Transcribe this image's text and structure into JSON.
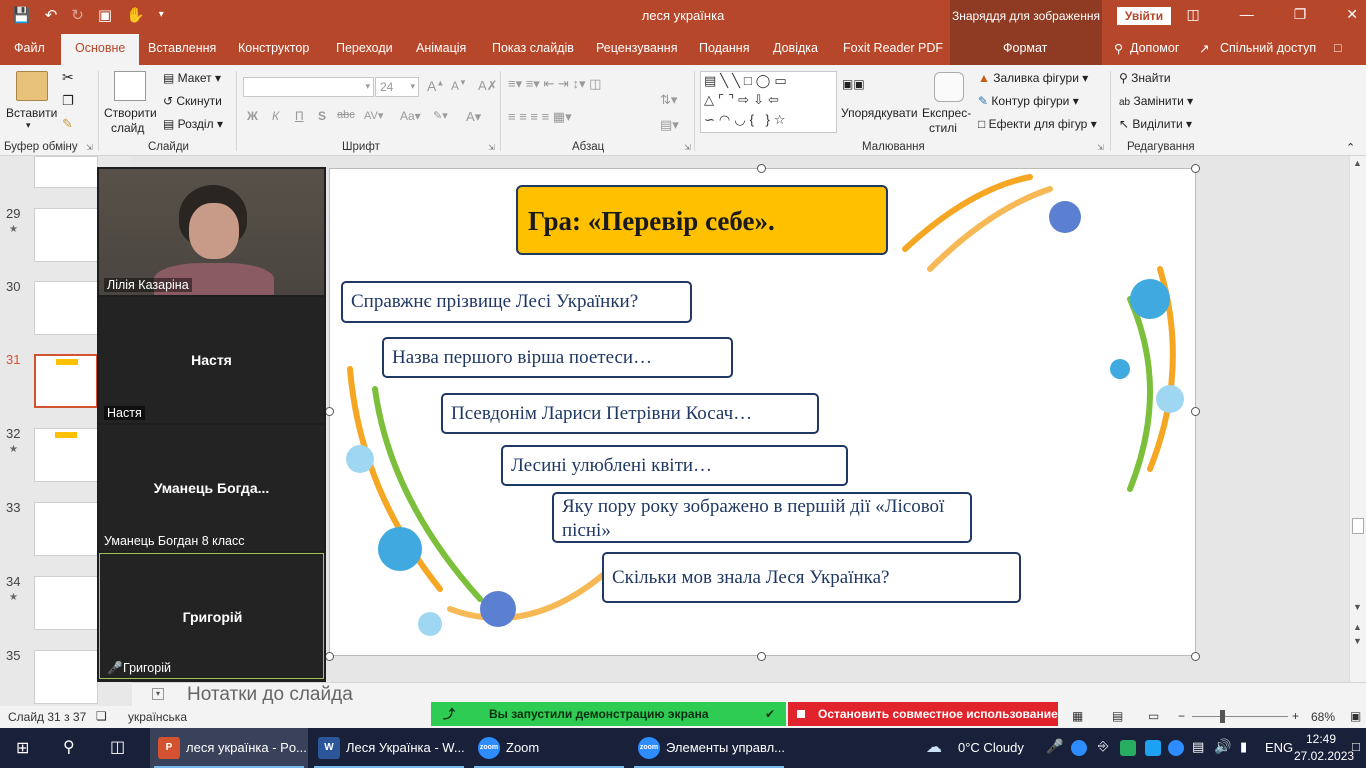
{
  "titlebar": {
    "doc_title": "леся українка",
    "context_tools": "Знаряддя для зображення",
    "signin": "Увійти"
  },
  "tabs": [
    "Файл",
    "Основне",
    "Вставлення",
    "Конструктор",
    "Переходи",
    "Анімація",
    "Показ слайдів",
    "Рецензування",
    "Подання",
    "Довідка",
    "Foxit Reader PDF",
    "Формат"
  ],
  "tabs_right": {
    "help": "Допомог",
    "share": "Спільний доступ"
  },
  "ribbon": {
    "paste": "Вставити",
    "clipboard_group": "Буфер обміну",
    "new_slide_1": "Створити",
    "new_slide_2": "слайд",
    "layout": "Макет",
    "reset": "Скинути",
    "section": "Розділ",
    "slides_group": "Слайди",
    "font_size": "24",
    "font_group": "Шрифт",
    "bold": "Ж",
    "italic": "К",
    "underline": "П",
    "shadow": "S",
    "strike": "abc",
    "paragraph_group": "Абзац",
    "arrange": "Упорядкувати",
    "quick_styles_1": "Експрес-",
    "quick_styles_2": "стилі",
    "shape_fill": "Заливка фігури",
    "shape_outline": "Контур фігури",
    "shape_effects": "Ефекти для фігур",
    "drawing_group": "Малювання",
    "find": "Знайти",
    "replace": "Замінити",
    "select": "Виділити",
    "editing_group": "Редагування"
  },
  "thumbnails": [
    {
      "num": "29",
      "star": "★"
    },
    {
      "num": "30",
      "star": ""
    },
    {
      "num": "31",
      "star": ""
    },
    {
      "num": "32",
      "star": "★"
    },
    {
      "num": "33",
      "star": ""
    },
    {
      "num": "34",
      "star": "★"
    },
    {
      "num": "35",
      "star": ""
    }
  ],
  "slide": {
    "title": "Гра: «Перевір себе».",
    "questions": [
      "Справжнє прізвище Лесі Українки?",
      "Назва першого вірша поетеси…",
      "Псевдонім Лариси Петрівни Косач…",
      "Лесині улюблені квіти…",
      "Яку пору року зображено в першій дії «Лісової пісні»",
      "Скільки мов знала Леся Українка?"
    ]
  },
  "zoom": {
    "participants": [
      {
        "label": "Лілія Казаріна",
        "center": ""
      },
      {
        "label": "Настя",
        "center": "Настя"
      },
      {
        "label": "Уманець Богдан 8 класс",
        "center": "Уманець  Богда..."
      },
      {
        "label": "Григорій",
        "center": "Григорій"
      }
    ]
  },
  "notes_placeholder": "Нотатки до слайда",
  "status": {
    "slide_counter": "Слайд 31 з 37",
    "language": "українська",
    "share_active": "Вы запустили демонстрацию экрана",
    "stop_share": "Остановить совместное использование",
    "zoom_level": "68%"
  },
  "taskbar": {
    "apps": [
      {
        "label": "леся українка - Po...",
        "icon": "powerpoint-icon"
      },
      {
        "label": "Леся Українка - W...",
        "icon": "word-icon"
      },
      {
        "label": "Zoom",
        "icon": "zoom-icon"
      },
      {
        "label": "Элементы управл...",
        "icon": "zoom-icon"
      }
    ],
    "weather": "0°C  Cloudy",
    "lang": "ENG",
    "time": "12:49",
    "date": "27.02.2023"
  },
  "colors": {
    "accent": "#b7472a",
    "title_fill": "#ffc000",
    "box_border": "#1f3864",
    "share_green": "#2fcc53",
    "share_red": "#e1232b"
  }
}
